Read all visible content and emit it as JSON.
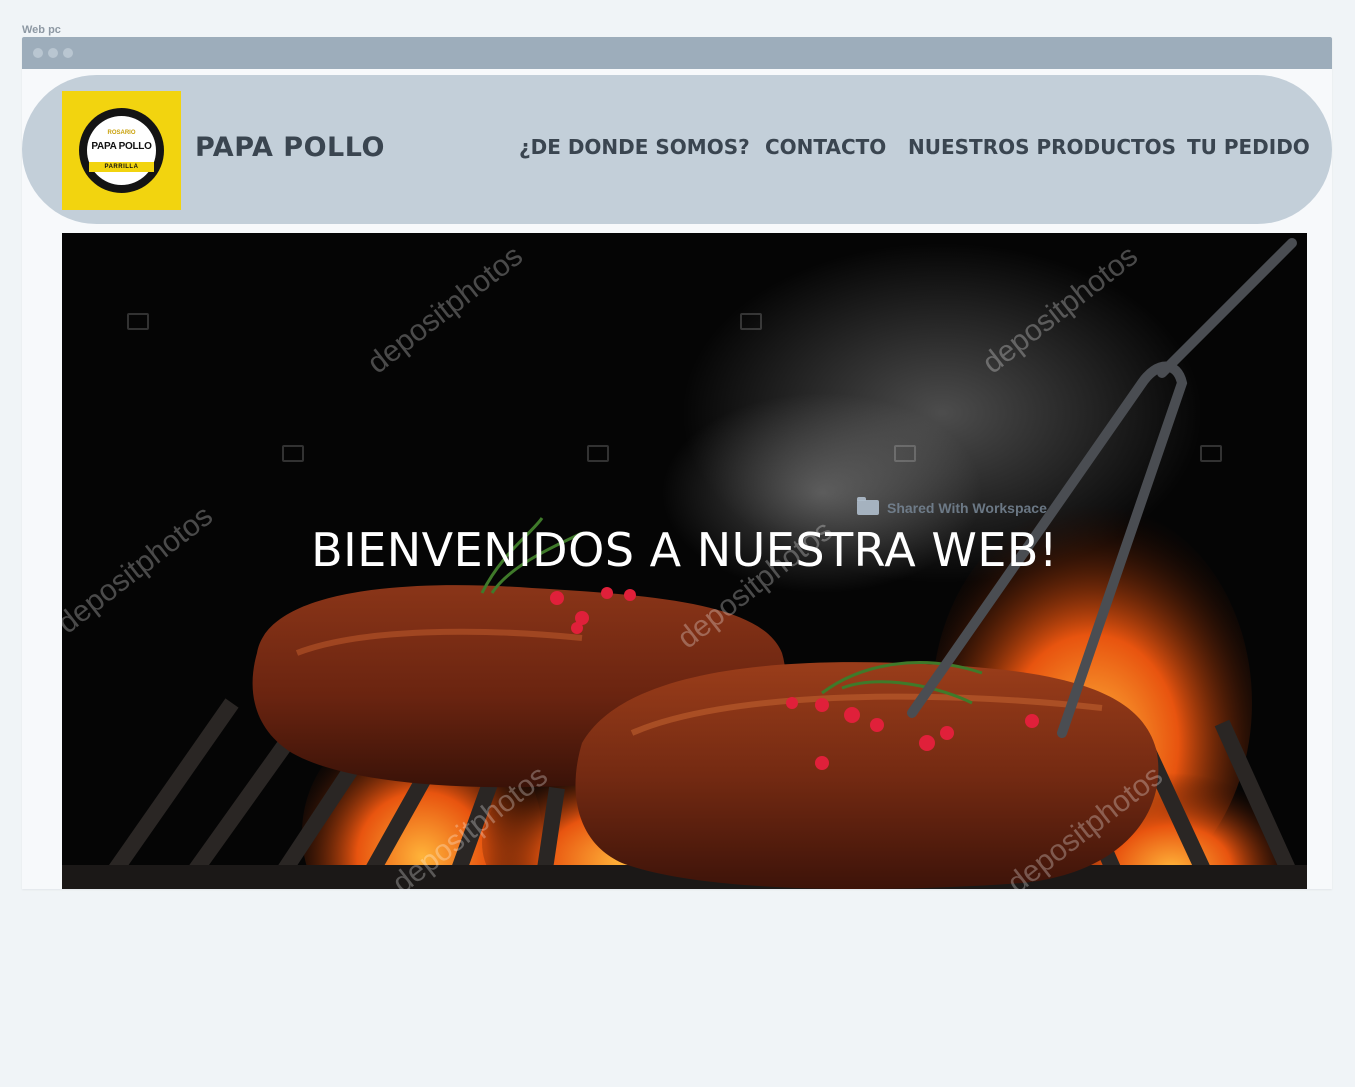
{
  "frame": {
    "label": "Web pc"
  },
  "window": {
    "dots": [
      "dot-1",
      "dot-2",
      "dot-3"
    ]
  },
  "header": {
    "logo": {
      "top_text": "ROSARIO",
      "main_text": "PAPA POLLO",
      "ribbon_text": "PARRILLA"
    },
    "brand": "PAPA POLLO",
    "nav": [
      {
        "label": "¿DE DONDE SOMOS?"
      },
      {
        "label": "CONTACTO"
      },
      {
        "label": "NUESTROS PRODUCTOS"
      },
      {
        "label": "TU PEDIDO"
      }
    ]
  },
  "hero": {
    "title": "BIENVENIDOS A NUESTRA WEB!",
    "watermark": "depositphotos",
    "overlay_tag": "Shared With Workspace"
  },
  "colors": {
    "page_bg": "#f0f4f7",
    "titlebar": "#9dadbb",
    "navbar": "#c3cfd9",
    "nav_text": "#3a4550",
    "logo_bg": "#f2d40f"
  }
}
